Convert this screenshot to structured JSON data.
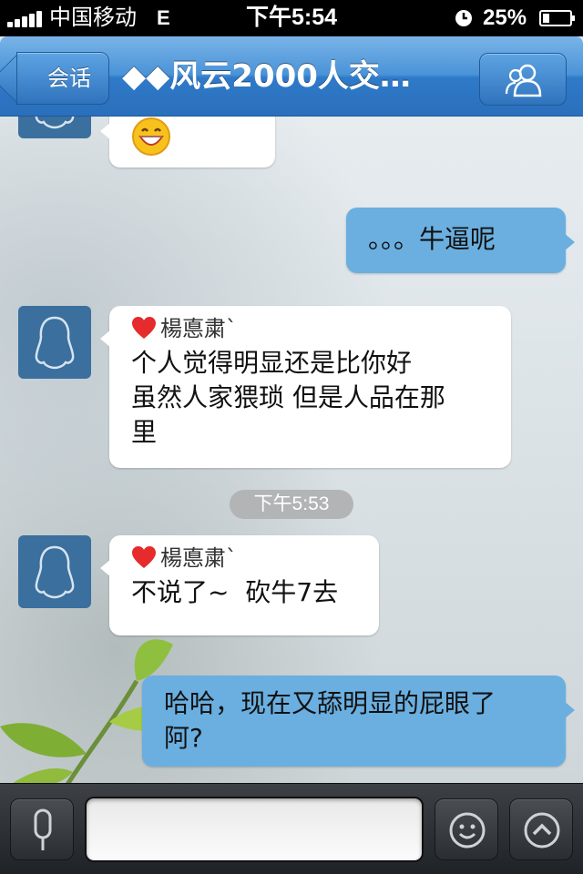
{
  "status_bar": {
    "carrier": "中国移动",
    "network": "E",
    "time": "下午5:54",
    "battery": "25%",
    "battery_level": 0.25
  },
  "nav": {
    "back_label": "会话",
    "title": "◆◆风云2000人交…",
    "members_icon": "group-members-icon"
  },
  "messages": [
    {
      "direction": "incoming",
      "type": "emoji",
      "emoji_icon": "grinning-face-icon"
    },
    {
      "direction": "outgoing",
      "text": "。。。牛逼呢"
    },
    {
      "direction": "incoming",
      "sender": "楊悳粛`",
      "lines": [
        "个人觉得明显还是比你好",
        "虽然人家猥琐 但是人品在那",
        "里"
      ]
    },
    {
      "direction": "timestamp",
      "text": "下午5:53"
    },
    {
      "direction": "incoming",
      "sender": "楊悳粛`",
      "text": "不说了~  砍牛7去"
    },
    {
      "direction": "outgoing",
      "lines": [
        "哈哈，现在又舔明显的屁眼了",
        "阿?"
      ]
    }
  ],
  "input_bar": {
    "voice_icon": "microphone-icon",
    "input_value": "",
    "emoji_icon": "smiley-icon",
    "more_icon": "chevron-up-icon"
  },
  "colors": {
    "nav_blue": "#3f88d2",
    "outgoing_bubble": "#6aafe0",
    "incoming_bubble": "#ffffff",
    "avatar_bg": "#3a6f9e",
    "timestamp_badge": "#b2b4b6"
  }
}
